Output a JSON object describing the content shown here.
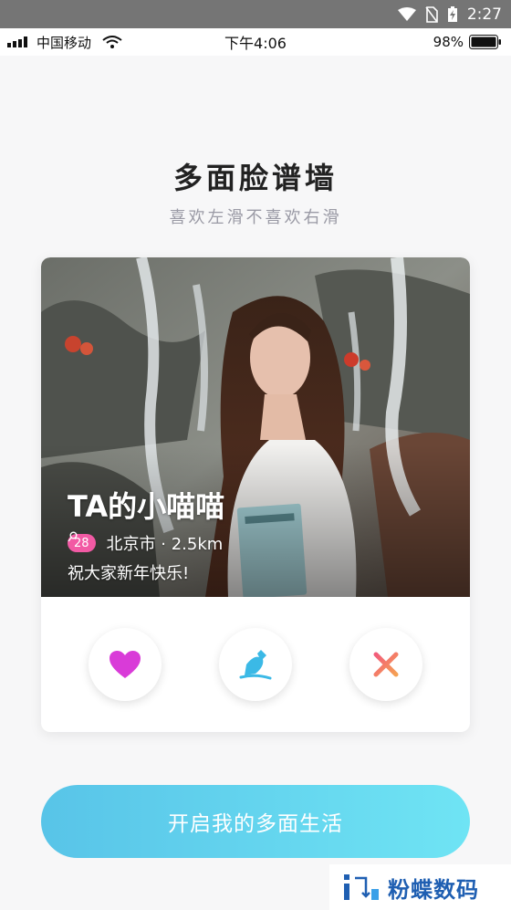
{
  "android_status": {
    "time": "2:27"
  },
  "ios_status": {
    "carrier": "中国移动",
    "time": "下午4:06",
    "battery": "98%"
  },
  "header": {
    "title": "多面脸谱墙",
    "subtitle": "喜欢左滑不喜欢右滑"
  },
  "profile": {
    "name": "TA的小喵喵",
    "age": "28",
    "location": "北京市 · 2.5km",
    "bio": "祝大家新年快乐!"
  },
  "cta": {
    "label": "开启我的多面生活"
  },
  "watermark": {
    "text": "粉蝶数码"
  },
  "colors": {
    "heart": "#d93bd8",
    "bottle": "#3bb9e6",
    "close": "#f06a6a",
    "age_badge": "#f25aa4",
    "cta_start": "#58c4e8",
    "cta_end": "#6fe4f4"
  }
}
